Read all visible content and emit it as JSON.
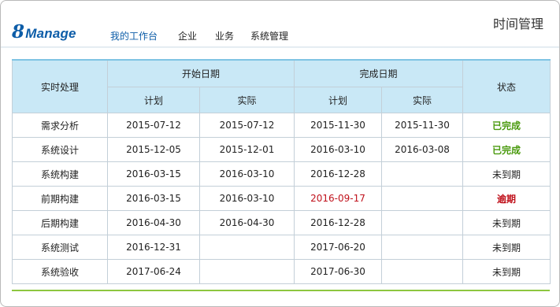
{
  "brand": {
    "logo_digit": "8",
    "logo_word": "Manage"
  },
  "nav": {
    "items": [
      {
        "label": "我的工作台",
        "active": true
      },
      {
        "label": "企业",
        "active": false
      },
      {
        "label": "业务",
        "active": false
      },
      {
        "label": "系统管理",
        "active": false
      }
    ]
  },
  "page_title": "时间管理",
  "table": {
    "headers": {
      "task": "实时处理",
      "start_group": "开始日期",
      "end_group": "完成日期",
      "status": "状态",
      "planned": "计划",
      "actual": "实际"
    },
    "rows": [
      {
        "task": "需求分析",
        "start_plan": "2015-07-12",
        "start_actual": "2015-07-12",
        "end_plan": "2015-11-30",
        "end_actual": "2015-11-30",
        "status": "已完成",
        "status_kind": "done"
      },
      {
        "task": "系统设计",
        "start_plan": "2015-12-05",
        "start_actual": "2015-12-01",
        "end_plan": "2016-03-10",
        "end_actual": "2016-03-08",
        "status": "已完成",
        "status_kind": "done"
      },
      {
        "task": "系统构建",
        "start_plan": "2016-03-15",
        "start_actual": "2016-03-10",
        "end_plan": "2016-12-28",
        "end_actual": "",
        "status": "未到期",
        "status_kind": "pending"
      },
      {
        "task": "前期构建",
        "start_plan": "2016-03-15",
        "start_actual": "2016-03-10",
        "end_plan": "2016-09-17",
        "end_actual": "",
        "status": "逾期",
        "status_kind": "overdue"
      },
      {
        "task": "后期构建",
        "start_plan": "2016-04-30",
        "start_actual": "2016-04-30",
        "end_plan": "2016-12-28",
        "end_actual": "",
        "status": "未到期",
        "status_kind": "pending"
      },
      {
        "task": "系统测试",
        "start_plan": "2016-12-31",
        "start_actual": "",
        "end_plan": "2017-06-20",
        "end_actual": "",
        "status": "未到期",
        "status_kind": "pending"
      },
      {
        "task": "系统验收",
        "start_plan": "2017-06-24",
        "start_actual": "",
        "end_plan": "2017-06-30",
        "end_actual": "",
        "status": "未到期",
        "status_kind": "pending"
      }
    ]
  },
  "colors": {
    "brand_blue": "#0d5da8",
    "header_fill": "#c9e8f6",
    "done_green": "#4a9a0e",
    "overdue_red": "#c0121c",
    "accent_line_green": "#8dc63f"
  }
}
